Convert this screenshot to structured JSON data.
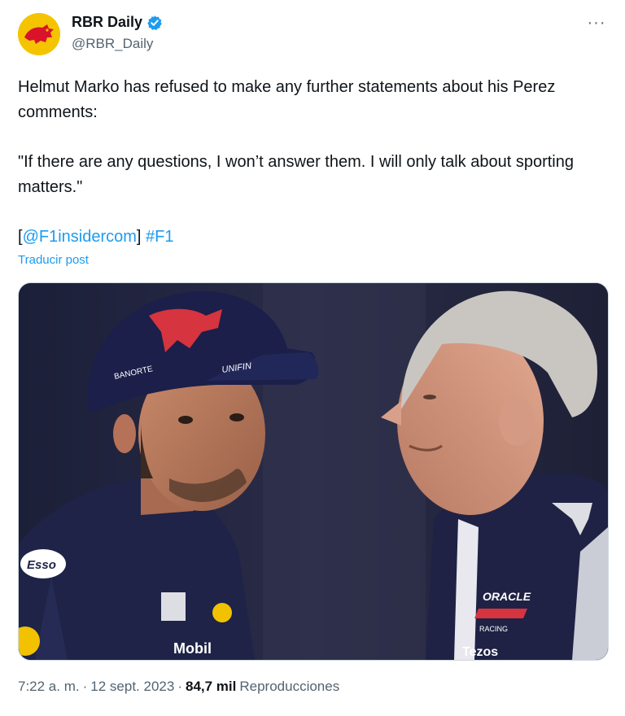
{
  "account": {
    "display_name": "RBR Daily",
    "handle": "@RBR_Daily",
    "verified": true,
    "avatar_icon": "red-bull-logo-icon"
  },
  "menu": {
    "more_label": "···"
  },
  "tweet": {
    "line1": "Helmut Marko has refused to make any further statements about his Perez comments:",
    "quote": "\"If there are any questions, I won’t answer them. I will only talk about sporting matters.\"",
    "bracket_open": "[",
    "mention": "@F1insidercom",
    "bracket_close": "]",
    "hashtag": "#F1",
    "translate_label": "Traducir post"
  },
  "media": {
    "description_icon": "photo-perez-and-marko",
    "cap_texts": [
      "BANORTE",
      "UNIFIN"
    ],
    "shirt_texts": [
      "ORACLE",
      "RACING",
      "Tezos",
      "Esso"
    ]
  },
  "meta": {
    "time": "7:22 a. m.",
    "separator": "·",
    "date": "12 sept. 2023",
    "views_count": "84,7 mil",
    "views_label": "Reproducciones"
  },
  "colors": {
    "link": "#1d9bf0",
    "secondary_text": "#536471",
    "verified": "#1d9bf0",
    "avatar_bg": "#f5c400"
  }
}
